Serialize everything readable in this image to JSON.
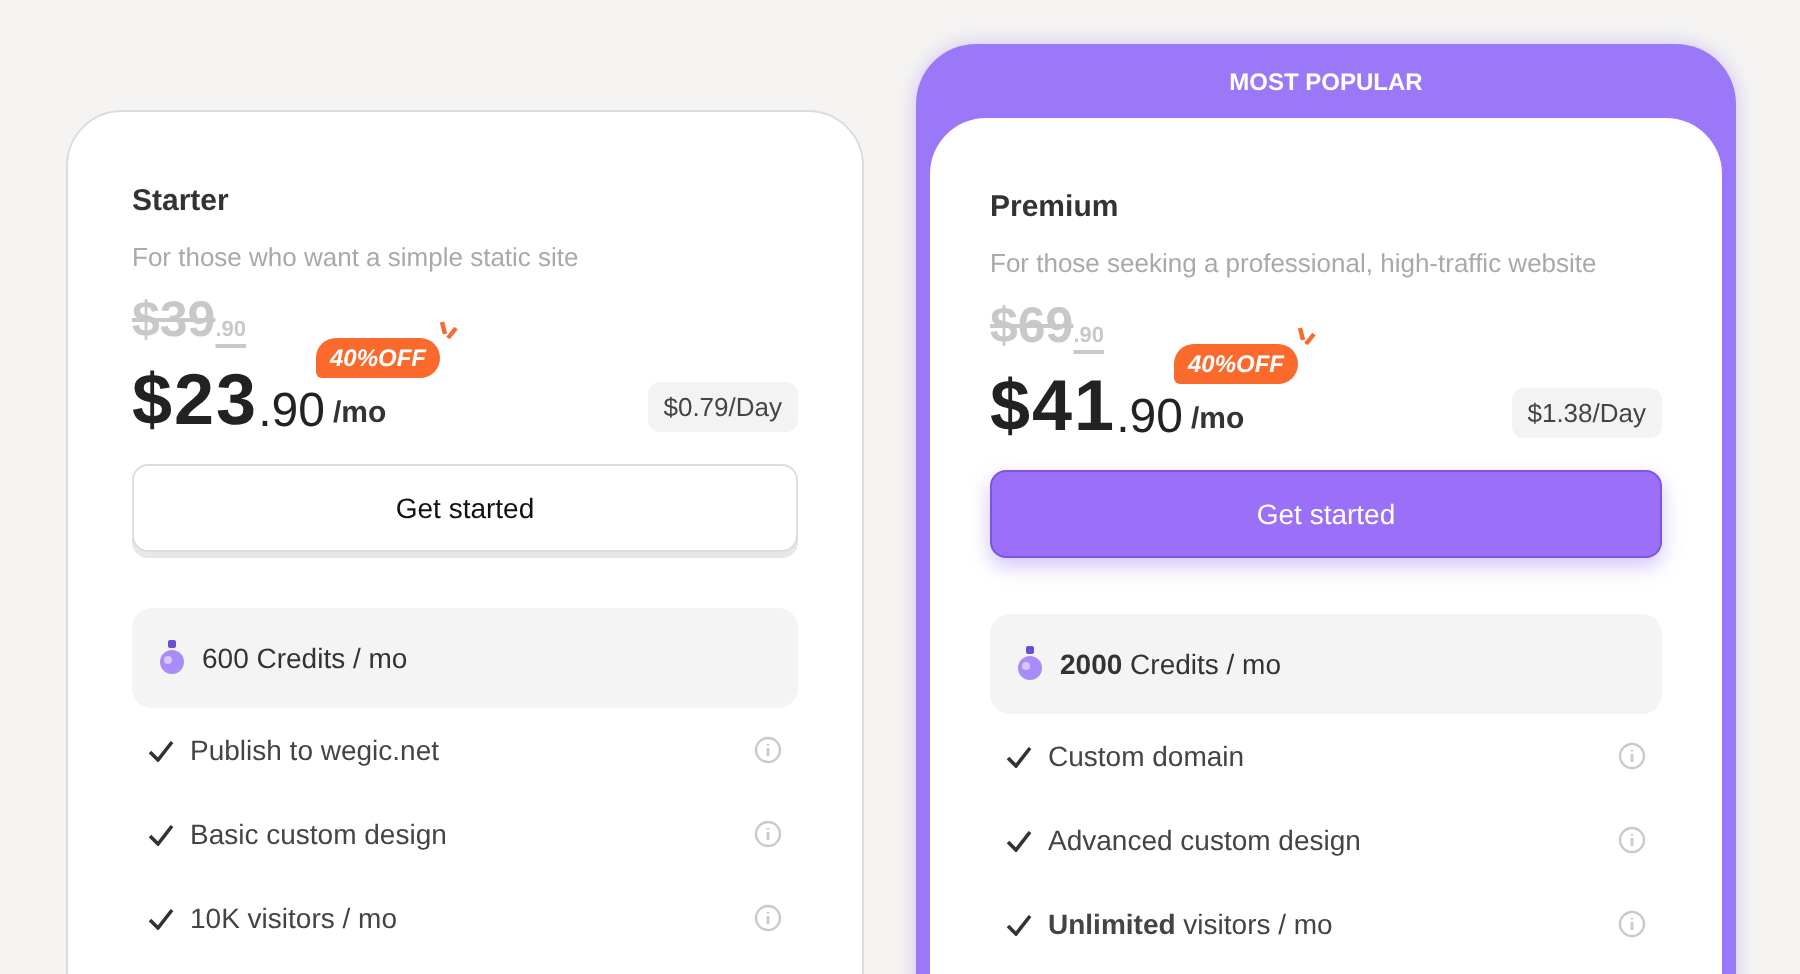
{
  "plans": [
    {
      "name": "Starter",
      "subtitle": "For those who want a simple static site",
      "highlighted": false,
      "old_price": "$39",
      "old_cents": ".90",
      "discount": "40%OFF",
      "price": "$23",
      "cents": ".90",
      "period": "/mo",
      "per_day": "$0.79/Day",
      "button": "Get started",
      "credits": "600 Credits / mo",
      "features": [
        "Publish to wegic.net",
        "Basic custom design",
        "10K visitors / mo"
      ]
    },
    {
      "badge": "MOST POPULAR",
      "name": "Premium",
      "subtitle": "For those seeking a professional, high-traffic website",
      "highlighted": true,
      "old_price": "$69",
      "old_cents": ".90",
      "discount": "40%OFF",
      "price": "$41",
      "cents": ".90",
      "period": "/mo",
      "per_day": "$1.38/Day",
      "button": "Get started",
      "credits": "**2000** Credits / mo",
      "features": [
        "Custom domain",
        "Advanced custom design",
        "**Unlimited** visitors / mo"
      ]
    }
  ]
}
